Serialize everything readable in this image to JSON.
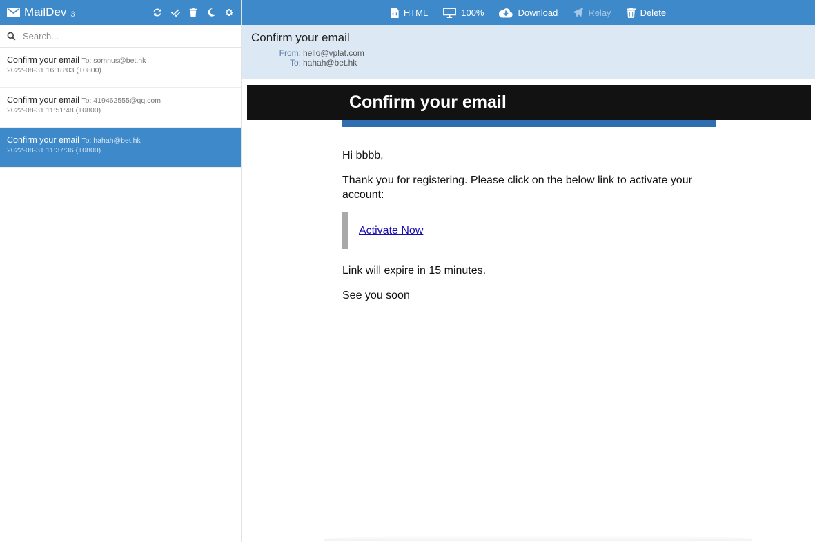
{
  "app": {
    "name": "MailDev",
    "count": "3"
  },
  "search": {
    "placeholder": "Search..."
  },
  "emails": [
    {
      "subject": "Confirm your email",
      "to": "To: somnus@bet.hk",
      "date": "2022-08-31 16:18:03 (+0800)"
    },
    {
      "subject": "Confirm your email",
      "to": "To: 419462555@qq.com",
      "date": "2022-08-31 11:51:48 (+0800)"
    },
    {
      "subject": "Confirm your email",
      "to": "To: hahah@bet.hk",
      "date": "2022-08-31 11:37:36 (+0800)"
    }
  ],
  "toolbar": {
    "html_label": "HTML",
    "zoom_label": "100%",
    "download_label": "Download",
    "relay_label": "Relay",
    "delete_label": "Delete"
  },
  "message": {
    "subject": "Confirm your email",
    "from_label": "From:",
    "from_value": "hello@vplat.com",
    "to_label": "To:",
    "to_value": "hahah@bet.hk"
  },
  "email_body": {
    "banner_title": "Confirm your email",
    "greeting": "Hi bbbb,",
    "intro": "Thank you for registering. Please click on the below link to activate your account:",
    "link_text": "Activate Now",
    "expiry": "Link will expire in 15 minutes.",
    "signoff": "See you soon"
  },
  "colors": {
    "accent": "#3d89c9",
    "header_bg": "#dce9f5",
    "banner_bg": "#121212",
    "banner_strip": "#2f6fb0"
  },
  "icons": [
    "envelope-icon",
    "refresh-icon",
    "check-all-icon",
    "trash-icon",
    "moon-icon",
    "gear-icon",
    "search-icon",
    "file-code-icon",
    "monitor-icon",
    "cloud-download-icon",
    "paper-plane-icon",
    "trash-icon"
  ]
}
